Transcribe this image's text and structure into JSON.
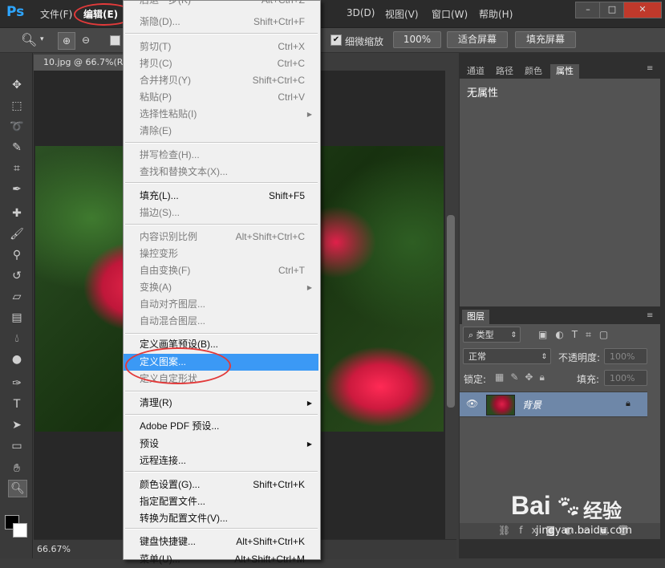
{
  "app": {
    "logo": "Ps"
  },
  "menubar": {
    "items": [
      "文件(F)",
      "编辑(E)",
      "3D(D)",
      "视图(V)",
      "窗口(W)",
      "帮助(H)"
    ],
    "window_buttons": [
      "–",
      "□",
      "✕"
    ]
  },
  "options_bar": {
    "scrubby_zoom_label": "细微缩放",
    "zoom_100": "100%",
    "fit_screen": "适合屏幕",
    "fill_screen": "填充屏幕"
  },
  "document": {
    "tab_title": "10.jpg @ 66.7%(R",
    "zoom_status": "66.67%"
  },
  "edit_menu": {
    "items": [
      {
        "label": "后退一步(K)",
        "shortcut": "Alt+Ctrl+Z",
        "disabled": true
      },
      {
        "label": "渐隐(D)...",
        "shortcut": "Shift+Ctrl+F",
        "disabled": true
      },
      {
        "label": "剪切(T)",
        "shortcut": "Ctrl+X",
        "disabled": true
      },
      {
        "label": "拷贝(C)",
        "shortcut": "Ctrl+C",
        "disabled": true
      },
      {
        "label": "合并拷贝(Y)",
        "shortcut": "Shift+Ctrl+C",
        "disabled": true
      },
      {
        "label": "粘贴(P)",
        "shortcut": "Ctrl+V",
        "disabled": true
      },
      {
        "label": "选择性粘贴(I)",
        "shortcut": "",
        "disabled": true,
        "submenu": true
      },
      {
        "label": "清除(E)",
        "shortcut": "",
        "disabled": true
      },
      {
        "label": "拼写检查(H)...",
        "shortcut": "",
        "disabled": true
      },
      {
        "label": "查找和替换文本(X)...",
        "shortcut": "",
        "disabled": true
      },
      {
        "label": "填充(L)...",
        "shortcut": "Shift+F5",
        "disabled": false
      },
      {
        "label": "描边(S)...",
        "shortcut": "",
        "disabled": true
      },
      {
        "label": "内容识别比例",
        "shortcut": "Alt+Shift+Ctrl+C",
        "disabled": true
      },
      {
        "label": "操控变形",
        "shortcut": "",
        "disabled": true
      },
      {
        "label": "自由变换(F)",
        "shortcut": "Ctrl+T",
        "disabled": true
      },
      {
        "label": "变换(A)",
        "shortcut": "",
        "disabled": true,
        "submenu": true
      },
      {
        "label": "自动对齐图层...",
        "shortcut": "",
        "disabled": true
      },
      {
        "label": "自动混合图层...",
        "shortcut": "",
        "disabled": true
      },
      {
        "label": "定义画笔预设(B)...",
        "shortcut": "",
        "disabled": false
      },
      {
        "label": "定义图案...",
        "shortcut": "",
        "disabled": false,
        "highlighted": true
      },
      {
        "label": "定义自定形状",
        "shortcut": "",
        "disabled": true
      },
      {
        "label": "清理(R)",
        "shortcut": "",
        "disabled": false,
        "submenu": true
      },
      {
        "label": "Adobe PDF 预设...",
        "shortcut": "",
        "disabled": false
      },
      {
        "label": "预设",
        "shortcut": "",
        "disabled": false,
        "submenu": true
      },
      {
        "label": "远程连接...",
        "shortcut": "",
        "disabled": false
      },
      {
        "label": "颜色设置(G)...",
        "shortcut": "Shift+Ctrl+K",
        "disabled": false
      },
      {
        "label": "指定配置文件...",
        "shortcut": "",
        "disabled": false
      },
      {
        "label": "转换为配置文件(V)...",
        "shortcut": "",
        "disabled": false
      },
      {
        "label": "键盘快捷键...",
        "shortcut": "Alt+Shift+Ctrl+K",
        "disabled": false
      },
      {
        "label": "菜单(U)...",
        "shortcut": "Alt+Shift+Ctrl+M",
        "disabled": false
      }
    ]
  },
  "properties_panel": {
    "tabs": [
      "通道",
      "路径",
      "颜色",
      "属性"
    ],
    "content": "无属性"
  },
  "layers_panel": {
    "tab": "图层",
    "filter_kind": "类型",
    "blend_mode": "正常",
    "opacity_label": "不透明度:",
    "opacity_value": "100%",
    "lock_label": "锁定:",
    "fill_label": "填充:",
    "fill_value": "100%",
    "layer_name": "背景"
  },
  "watermark": {
    "brand": "Bai",
    "brand_cn": "经验",
    "url": "jingyan.baidu.com"
  },
  "colors": {
    "highlight": "#3b99f5",
    "annotation": "#e23a3a",
    "ps_blue": "#2ea6ff"
  }
}
